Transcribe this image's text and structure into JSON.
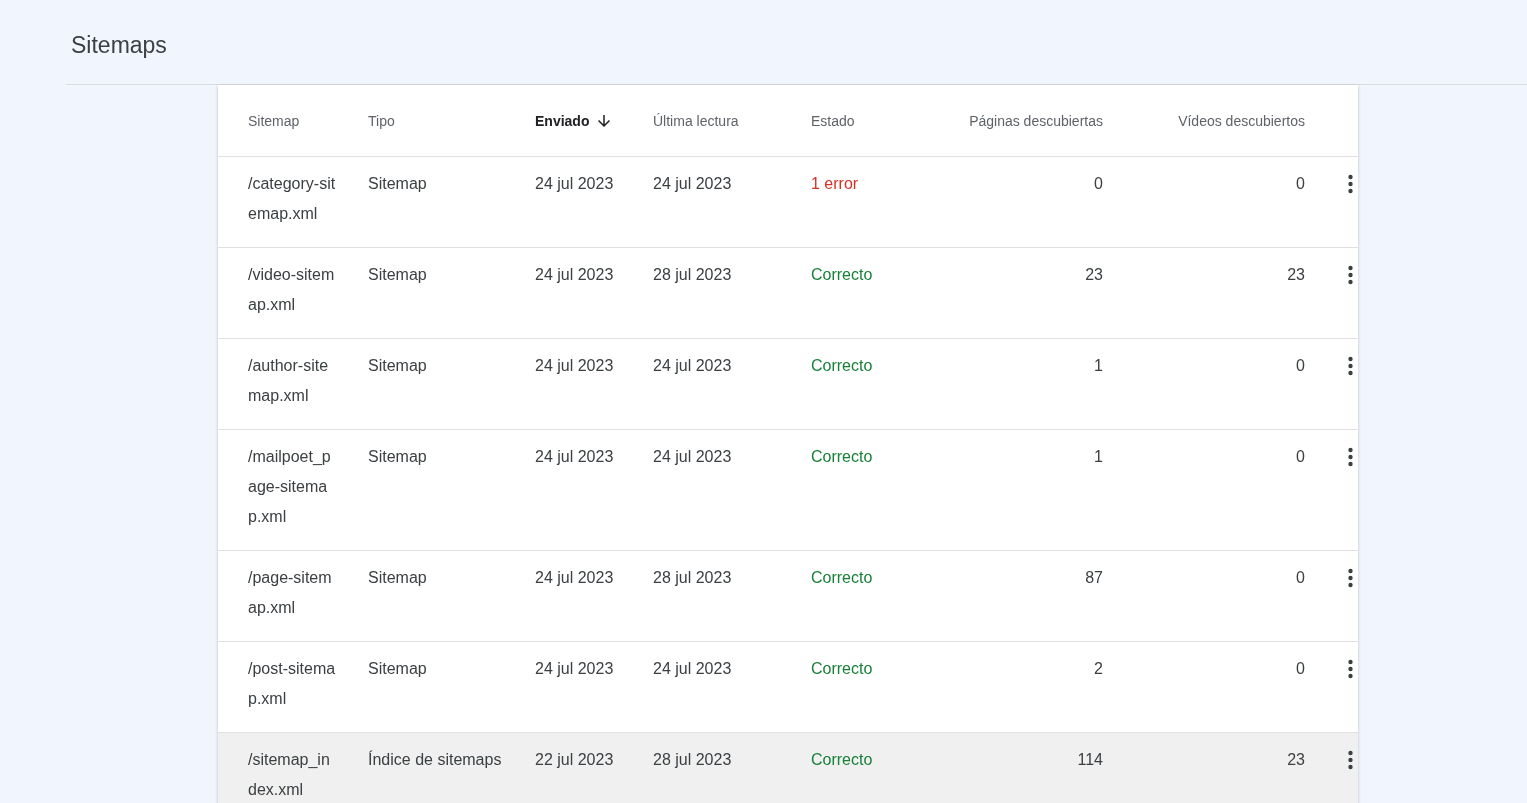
{
  "page": {
    "title": "Sitemaps"
  },
  "table": {
    "columns": [
      {
        "label": "Sitemap",
        "sorted": false
      },
      {
        "label": "Tipo",
        "sorted": false
      },
      {
        "label": "Enviado",
        "sorted": true
      },
      {
        "label": "Última lectura",
        "sorted": false
      },
      {
        "label": "Estado",
        "sorted": false
      },
      {
        "label": "Páginas descubiertas",
        "sorted": false
      },
      {
        "label": "Vídeos descubiertos",
        "sorted": false
      }
    ],
    "rows": [
      {
        "sitemap": "/category-sitemap.xml",
        "type": "Sitemap",
        "submitted": "24 jul 2023",
        "last_read": "24 jul 2023",
        "status": {
          "kind": "error",
          "text": "1 error"
        },
        "pages": "0",
        "videos": "0",
        "highlighted": false
      },
      {
        "sitemap": "/video-sitemap.xml",
        "type": "Sitemap",
        "submitted": "24 jul 2023",
        "last_read": "28 jul 2023",
        "status": {
          "kind": "ok",
          "text": "Correcto"
        },
        "pages": "23",
        "videos": "23",
        "highlighted": false
      },
      {
        "sitemap": "/author-sitemap.xml",
        "type": "Sitemap",
        "submitted": "24 jul 2023",
        "last_read": "24 jul 2023",
        "status": {
          "kind": "ok",
          "text": "Correcto"
        },
        "pages": "1",
        "videos": "0",
        "highlighted": false
      },
      {
        "sitemap": "/mailpoet_page-sitemap.xml",
        "type": "Sitemap",
        "submitted": "24 jul 2023",
        "last_read": "24 jul 2023",
        "status": {
          "kind": "ok",
          "text": "Correcto"
        },
        "pages": "1",
        "videos": "0",
        "highlighted": false
      },
      {
        "sitemap": "/page-sitemap.xml",
        "type": "Sitemap",
        "submitted": "24 jul 2023",
        "last_read": "28 jul 2023",
        "status": {
          "kind": "ok",
          "text": "Correcto"
        },
        "pages": "87",
        "videos": "0",
        "highlighted": false
      },
      {
        "sitemap": "/post-sitemap.xml",
        "type": "Sitemap",
        "submitted": "24 jul 2023",
        "last_read": "24 jul 2023",
        "status": {
          "kind": "ok",
          "text": "Correcto"
        },
        "pages": "2",
        "videos": "0",
        "highlighted": false
      },
      {
        "sitemap": "/sitemap_index.xml",
        "type": "Índice de sitemaps",
        "submitted": "22 jul 2023",
        "last_read": "28 jul 2023",
        "status": {
          "kind": "ok",
          "text": "Correcto"
        },
        "pages": "114",
        "videos": "23",
        "highlighted": true
      }
    ]
  }
}
